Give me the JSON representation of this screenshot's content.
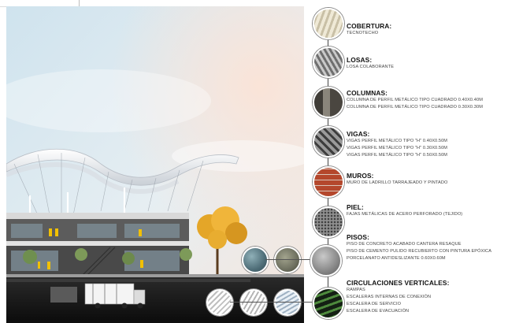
{
  "legend": [
    {
      "title": "COBERTURA:",
      "lines": [
        "TECNOTECHO"
      ],
      "icon": "corrugated-sheet-icon",
      "color": "#d7d0c0"
    },
    {
      "title": "LOSAS:",
      "lines": [
        "LOSA COLABORANTE"
      ],
      "icon": "steel-deck-icon",
      "color": "#8d8d8d"
    },
    {
      "title": "COLUMNAS:",
      "lines": [
        "COLUMNA DE PERFIL METÁLICO TIPO CUADRADO 0.40X0.40M",
        "COLUMNA DE PERFIL METÁLICO TIPO CUADRADO 0.30X0.30M"
      ],
      "icon": "square-column-icon",
      "color": "#5e5a54"
    },
    {
      "title": "VIGAS:",
      "lines": [
        "VIGAS PERFIL METÁLICO TIPO \"H\" 0.40X0.50M",
        "VIGAS PERFIL METÁLICO TIPO \"H\" 0.30X0.50M",
        "VIGAS PERFIL METÁLICO TIPO \"H\" 0.50X0.50M"
      ],
      "icon": "h-beam-icon",
      "color": "#6d6d6d"
    },
    {
      "title": "MUROS:",
      "lines": [
        "MURO DE LADRILLO TARRAJEADO Y PINTADO"
      ],
      "icon": "brick-wall-icon",
      "color": "#b4472c"
    },
    {
      "title": "PIEL:",
      "lines": [
        "FAJAS METÁLICAS DE ACERO PERFORADO (TEJIDO)"
      ],
      "icon": "perforated-steel-icon",
      "color": "#747474"
    },
    {
      "title": "PISOS:",
      "lines": [
        "PISO DE CONCRETO ACABADO CANTERA RESAQUE",
        "PISO DE CEMENTO PULIDO RECUBIERTO CON PINTURA EPÓXICA",
        "PORCELANATO ANTIDESLIZANTE 0.60X0.60M"
      ],
      "icon": "concrete-floor-icon",
      "color": "#8c8c8c"
    },
    {
      "title": "CIRCULACIONES VERTICALES:",
      "lines": [
        "RAMPAS",
        "ESCALERAS INTERNAS DE CONEXIÓN",
        "ESCALERA DE SERVICIO",
        "ESCALERA DE EVACUACIÓN"
      ],
      "icon": "ramp-icon",
      "color": "#1f2b1f"
    }
  ],
  "floor_samples": [
    {
      "icon": "epoxy-floor-icon",
      "color": "#4f6e78"
    },
    {
      "icon": "stone-floor-icon",
      "color": "#6e7060"
    }
  ],
  "stair_samples": [
    {
      "icon": "stair-render-icon",
      "color": "#d7d7d7"
    },
    {
      "icon": "stair-render-icon",
      "color": "#cfcfcf"
    },
    {
      "icon": "stair-render-icon",
      "color": "#c8d2dc"
    }
  ]
}
